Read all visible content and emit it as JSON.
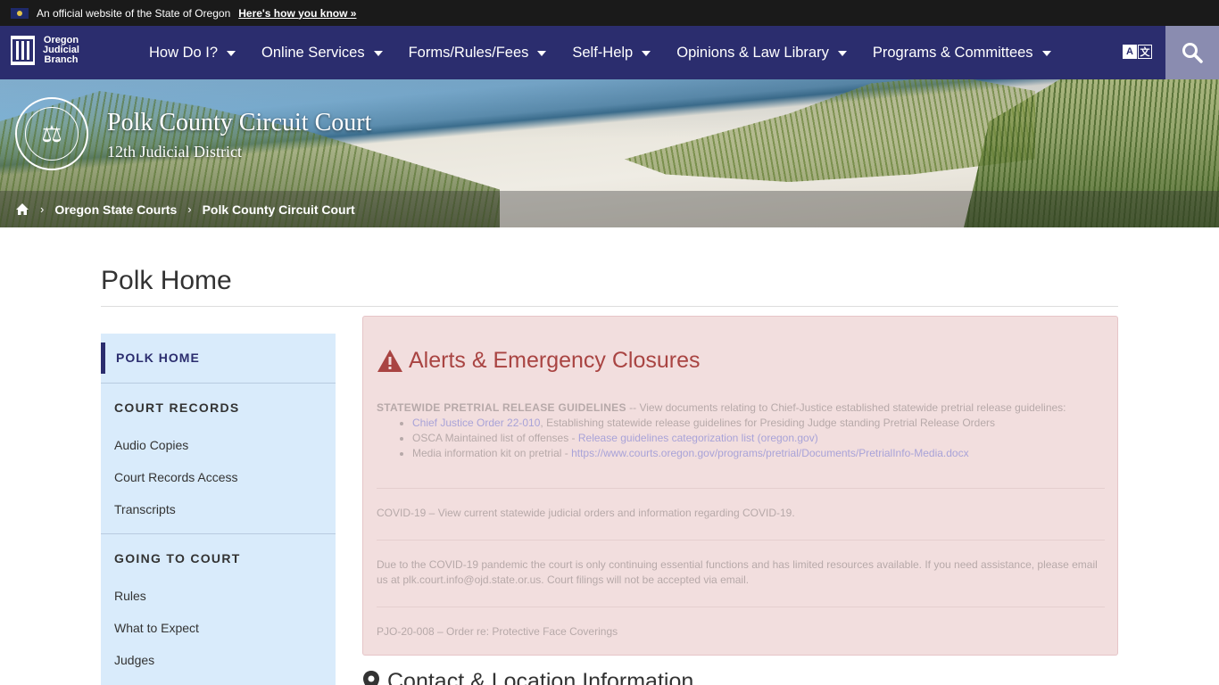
{
  "gov_banner": {
    "text": "An official website of the State of Oregon",
    "how_link": "Here's how you know »"
  },
  "brand": {
    "line1": "Oregon",
    "line2": "Judicial",
    "line3": "Branch"
  },
  "nav": {
    "items": [
      {
        "label": "How Do I?"
      },
      {
        "label": "Online Services"
      },
      {
        "label": "Forms/Rules/Fees"
      },
      {
        "label": "Self-Help"
      },
      {
        "label": "Opinions & Law Library"
      },
      {
        "label": "Programs & Committees"
      }
    ],
    "translate_a": "A",
    "translate_b": "文",
    "search_icon": "search-icon"
  },
  "hero": {
    "title": "Polk County Circuit Court",
    "subtitle": "12th Judicial District",
    "seal_glyph": "⚖"
  },
  "breadcrumb": {
    "items": [
      "Oregon State Courts",
      "Polk County Circuit Court"
    ],
    "separator": "›"
  },
  "page": {
    "title": "Polk Home"
  },
  "sidebar": {
    "current": "POLK HOME",
    "sections": [
      {
        "heading": "COURT RECORDS",
        "links": [
          "Audio Copies",
          "Court Records Access",
          "Transcripts"
        ]
      },
      {
        "heading": "GOING TO COURT",
        "links": [
          "Rules",
          "What to Expect",
          "Judges"
        ]
      }
    ]
  },
  "alert": {
    "title": "Alerts & Emergency Closures",
    "lead": "STATEWIDE PRETRIAL RELEASE GUIDELINES",
    "lead_rest": " -- View documents relating to Chief-Justice established statewide pretrial release guidelines:",
    "bullets": [
      {
        "link": "Chief Justice Order 22-010",
        "text": ", Establishing statewide release guidelines for Presiding Judge standing Pretrial Release Orders"
      },
      {
        "pre": "OSCA Maintained list of offenses - ",
        "link": "Release guidelines categorization list (oregon.gov)"
      },
      {
        "pre": "Media information kit on pretrial - ",
        "link": "https://www.courts.oregon.gov/programs/pretrial/Documents/PretrialInfo-Media.docx"
      }
    ],
    "covid_pre": "COVID-19 – View ",
    "covid_link": "current statewide judicial orders and information regarding COVID-19.",
    "pandemic_pre": "Due to the COVID-19 pandemic the court is only continuing essential functions and has limited resources available.  If you need assistance, please email us at ",
    "pandemic_email": "plk.court.info@ojd.state.or.us",
    "pandemic_post": ".  Court filings will not be accepted via email.",
    "pjo_link": "PJO-20-008 – Order re: Protective Face Coverings"
  },
  "contact": {
    "title": "Contact & Location Information"
  },
  "colors": {
    "nav_bg": "#2b2d6e",
    "alert_bg": "#f2dede",
    "alert_title": "#a94442",
    "sidebar_bg": "#d9ebfb"
  }
}
